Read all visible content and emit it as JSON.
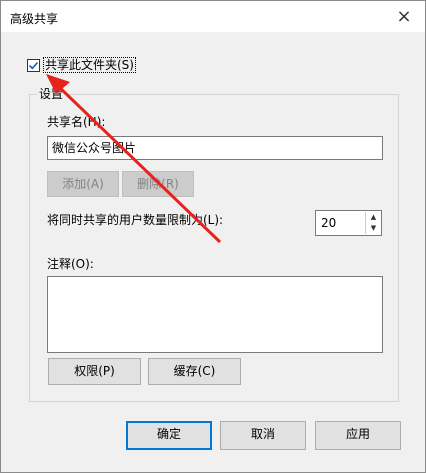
{
  "dialog": {
    "title": "高级共享",
    "close_glyph": "×"
  },
  "share_checkbox": {
    "label": "共享此文件夹(S)",
    "checked": true
  },
  "settings": {
    "group_label": "设置",
    "share_name_label": "共享名(H):",
    "share_name_value": "微信公众号图片",
    "add_button": "添加(A)",
    "remove_button": "删除(R)",
    "user_limit_label": "将同时共享的用户数量限制为(L):",
    "user_limit_value": "20",
    "comment_label": "注释(O):",
    "comment_value": "",
    "permissions_button": "权限(P)",
    "caching_button": "缓存(C)"
  },
  "footer": {
    "ok_button": "确定",
    "cancel_button": "取消",
    "apply_button": "应用"
  },
  "colors": {
    "annotation_arrow": "#e8231c",
    "focus_border": "#0078d7"
  }
}
